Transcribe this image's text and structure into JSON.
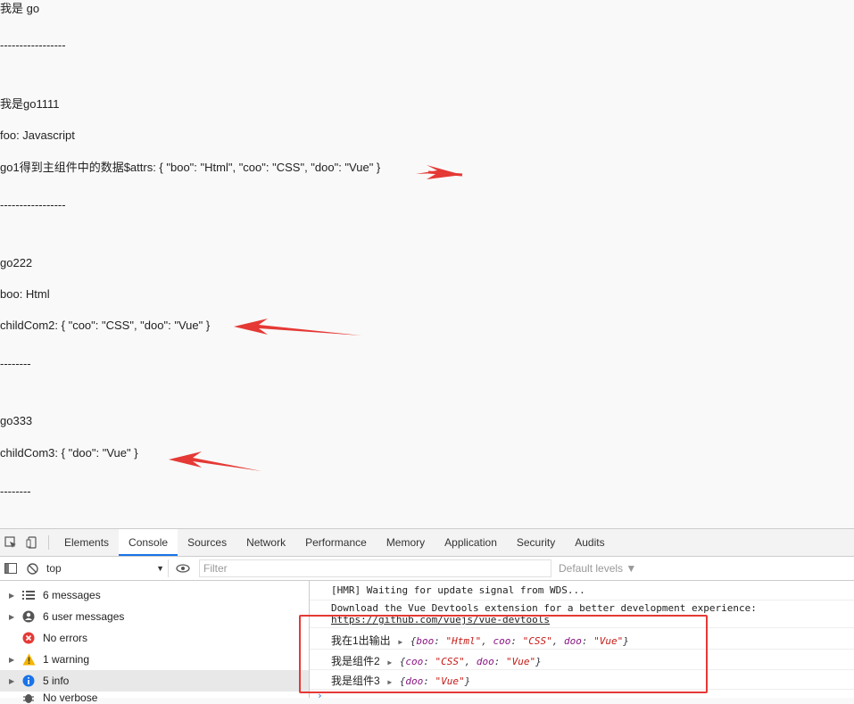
{
  "page": {
    "lines": [
      "我是 go",
      "-----------------",
      "我是go1111",
      "foo: Javascript",
      "go1得到主组件中的数据$attrs: { \"boo\": \"Html\", \"coo\": \"CSS\", \"doo\": \"Vue\" }",
      "-----------------",
      "go222",
      "boo: Html",
      "childCom2: { \"coo\": \"CSS\", \"doo\": \"Vue\" }",
      "--------",
      "go333",
      "childCom3: { \"doo\": \"Vue\" }",
      "--------"
    ]
  },
  "devtools": {
    "tabs": [
      "Elements",
      "Console",
      "Sources",
      "Network",
      "Performance",
      "Memory",
      "Application",
      "Security",
      "Audits"
    ],
    "active_tab": "Console",
    "context": "top",
    "filter_placeholder": "Filter",
    "levels": "Default levels ▼",
    "sidebar": [
      {
        "label": "6 messages",
        "icon": "list-icon"
      },
      {
        "label": "6 user messages",
        "icon": "user-icon"
      },
      {
        "label": "No errors",
        "icon": "error-icon"
      },
      {
        "label": "1 warning",
        "icon": "warning-icon"
      },
      {
        "label": "5 info",
        "icon": "info-icon"
      },
      {
        "label": "No verbose",
        "icon": "bug-icon"
      }
    ],
    "console": {
      "hmr": "[HMR] Waiting for update signal from WDS...",
      "devtools_line": "Download the Vue Devtools extension for a better development experience:",
      "devtools_link": "https://github.com/vuejs/vue-devtools",
      "log1_label": "我在1出输出",
      "log2_label": "我是组件2",
      "log3_label": "我是组件3"
    }
  },
  "colors": {
    "accent": "#1a73e8",
    "annotation": "#e53935"
  }
}
